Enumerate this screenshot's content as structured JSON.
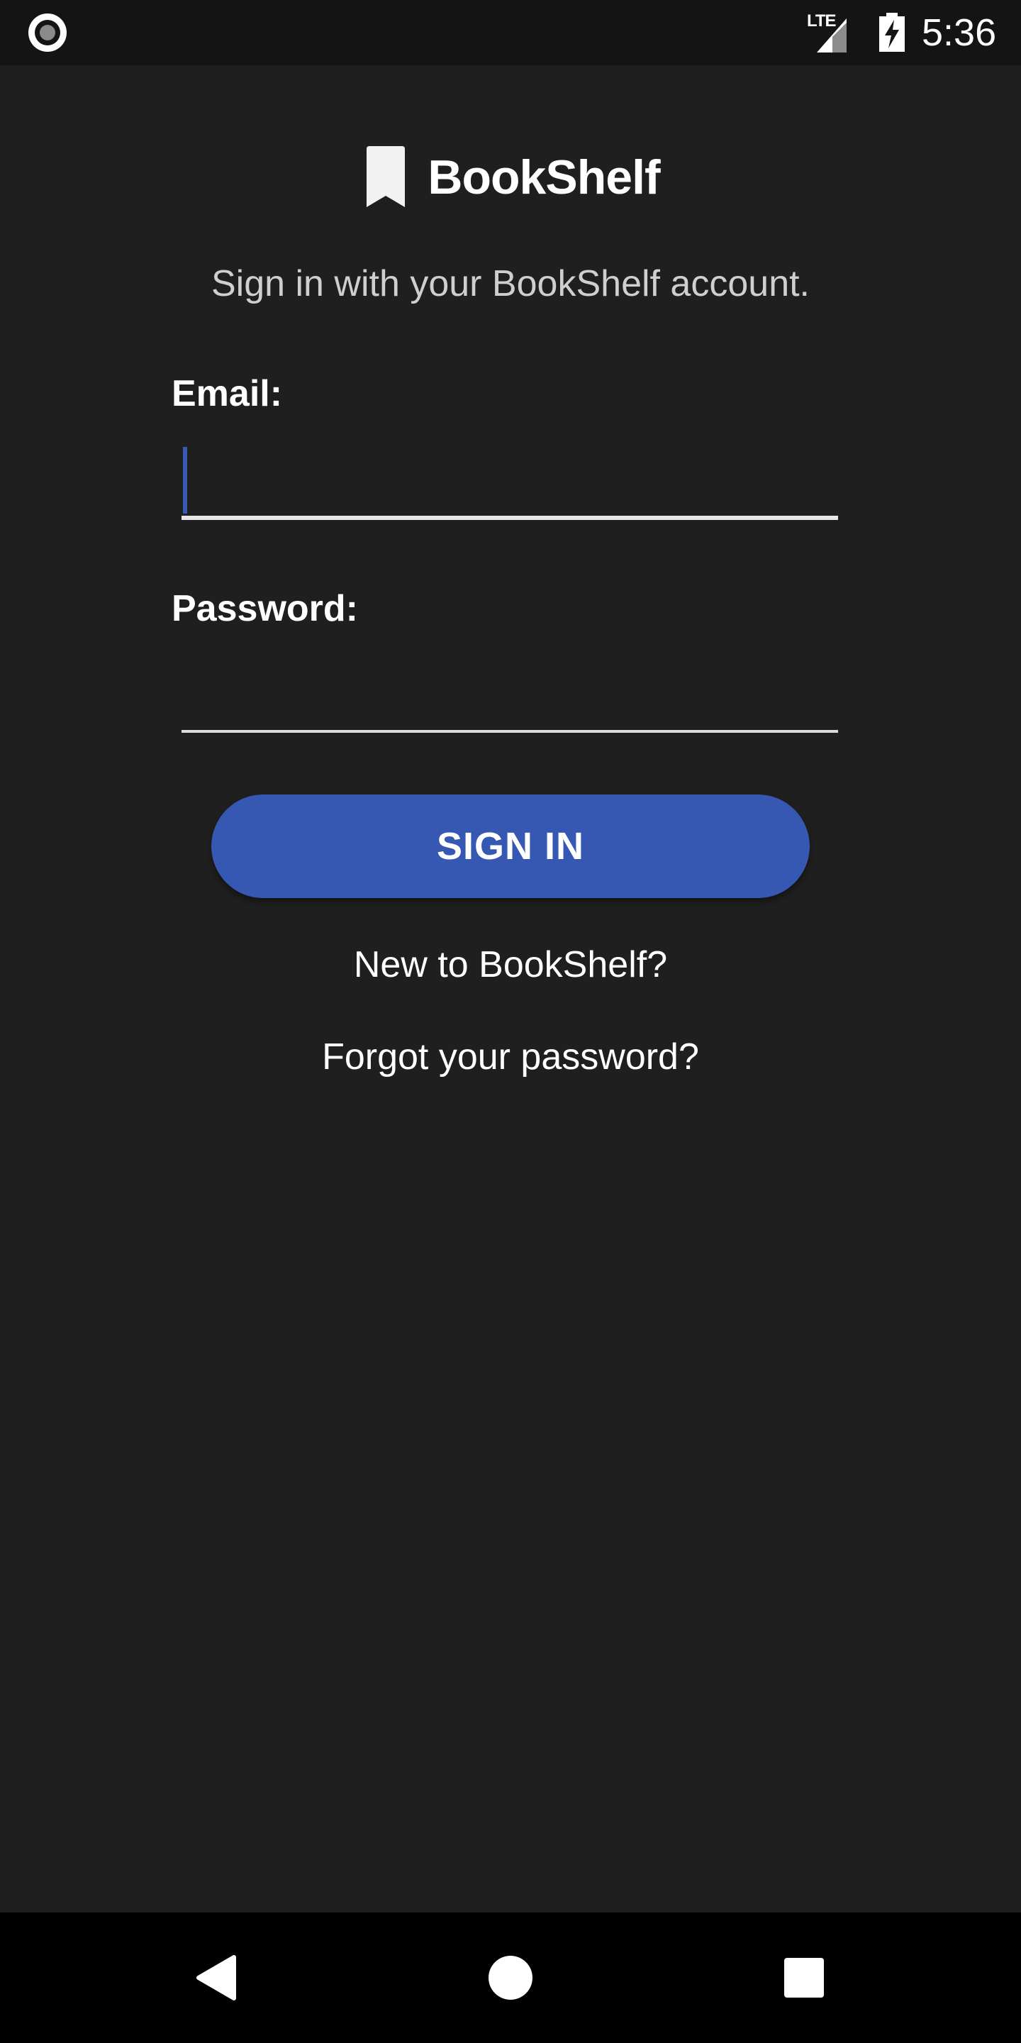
{
  "status_bar": {
    "time": "5:36",
    "network_label": "LTE",
    "icons": [
      "record-icon",
      "signal-icon",
      "battery-charging-icon"
    ]
  },
  "header": {
    "icon": "bookmark-icon",
    "title": "BookShelf"
  },
  "subtitle": "Sign in with your BookShelf account.",
  "form": {
    "email_label": "Email:",
    "email_value": "",
    "password_label": "Password:",
    "password_value": "",
    "submit_label": "SIGN IN"
  },
  "links": {
    "new_user": "New to BookShelf?",
    "forgot_password": "Forgot your password?"
  },
  "nav_bar": {
    "icons": [
      "back-icon",
      "home-icon",
      "recents-icon"
    ]
  },
  "colors": {
    "background": "#1f1f1f",
    "accent": "#3658b2",
    "status_bar": "#141414",
    "nav_bar": "#000000"
  }
}
